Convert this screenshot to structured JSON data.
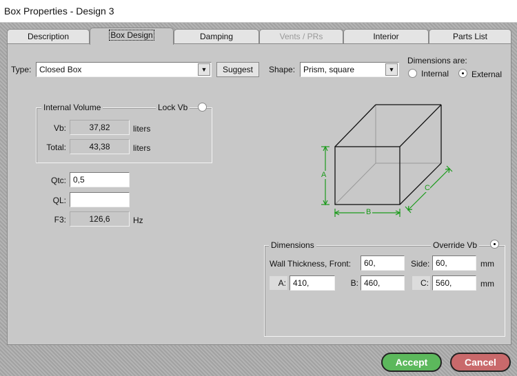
{
  "window": {
    "title": "Box Properties - Design 3"
  },
  "tabs": [
    {
      "label": "Description"
    },
    {
      "label": "Box Design"
    },
    {
      "label": "Damping"
    },
    {
      "label": "Vents / PRs"
    },
    {
      "label": "Interior"
    },
    {
      "label": "Parts List"
    }
  ],
  "type": {
    "label": "Type:",
    "value": "Closed Box",
    "suggest": "Suggest"
  },
  "shape": {
    "label": "Shape:",
    "value": "Prism, square"
  },
  "dims_are": {
    "label": "Dimensions are:",
    "internal": "Internal",
    "external": "External"
  },
  "internal_volume": {
    "title": "Internal Volume",
    "lock": "Lock Vb",
    "vb_label": "Vb:",
    "vb": "37,82",
    "vb_unit": "liters",
    "total_label": "Total:",
    "total": "43,38",
    "total_unit": "liters"
  },
  "q": {
    "qtc_label": "Qtc:",
    "qtc": "0,5",
    "ql_label": "QL:",
    "ql": "",
    "f3_label": "F3:",
    "f3": "126,6",
    "f3_unit": "Hz"
  },
  "diagram": {
    "a": "A",
    "b": "B",
    "c": "C",
    "color": "#1a9a1a"
  },
  "dimensions": {
    "title": "Dimensions",
    "override": "Override Vb",
    "wall_label": "Wall Thickness, Front:",
    "front": "60,",
    "side_label": "Side:",
    "side": "60,",
    "unit1": "mm",
    "a_label": "A:",
    "a": "410,",
    "b_label": "B:",
    "b": "460,",
    "c_label": "C:",
    "c": "560,",
    "unit2": "mm"
  },
  "buttons": {
    "accept": "Accept",
    "cancel": "Cancel"
  }
}
